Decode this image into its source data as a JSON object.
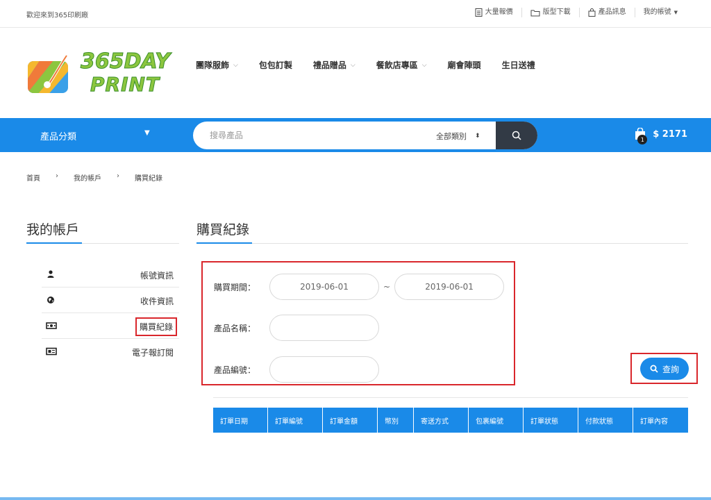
{
  "topbar": {
    "welcome": "歡迎來到365印刷廠",
    "links": [
      "大量報價",
      "版型下載",
      "產品訊息",
      "我的帳號"
    ]
  },
  "logo": {
    "line1": "365DAY",
    "line2": "PRINT"
  },
  "nav": {
    "items": [
      {
        "label": "團隊服飾",
        "has_dropdown": true
      },
      {
        "label": "包包訂製",
        "has_dropdown": false
      },
      {
        "label": "禮品贈品",
        "has_dropdown": true
      },
      {
        "label": "餐飲店專區",
        "has_dropdown": true
      },
      {
        "label": "廟會陣頭",
        "has_dropdown": false
      },
      {
        "label": "生日送禮",
        "has_dropdown": false
      }
    ]
  },
  "bluebar": {
    "category_label": "產品分類",
    "search_placeholder": "搜尋產品",
    "search_category": "全部類別",
    "cart_count": "1",
    "cart_total": "$ 2171"
  },
  "breadcrumb": [
    "首頁",
    "我的帳戶",
    "購買紀錄"
  ],
  "sidebar": {
    "title": "我的帳戶",
    "items": [
      {
        "label": "帳號資訊",
        "icon": "user-icon"
      },
      {
        "label": "收件資訊",
        "icon": "globe-icon"
      },
      {
        "label": "購買紀錄",
        "icon": "money-icon"
      },
      {
        "label": "電子報訂閱",
        "icon": "newspaper-icon"
      }
    ]
  },
  "main": {
    "title": "購買紀錄",
    "period_label": "購買期間：",
    "date_from": "2019-06-01",
    "date_to": "2019-06-01",
    "tilde": "~",
    "product_name_label": "產品名稱：",
    "product_name_value": "",
    "product_id_label": "產品編號：",
    "product_id_value": "",
    "query_label": "查詢"
  },
  "table": {
    "columns": [
      "訂單日期",
      "訂單編號",
      "訂單金額",
      "幣別",
      "寄送方式",
      "包裹編號",
      "訂單狀態",
      "付款狀態",
      "訂單內容"
    ]
  },
  "colors": {
    "accent": "#1a8ae8",
    "highlight": "#d9262b",
    "dark": "#323a45"
  }
}
